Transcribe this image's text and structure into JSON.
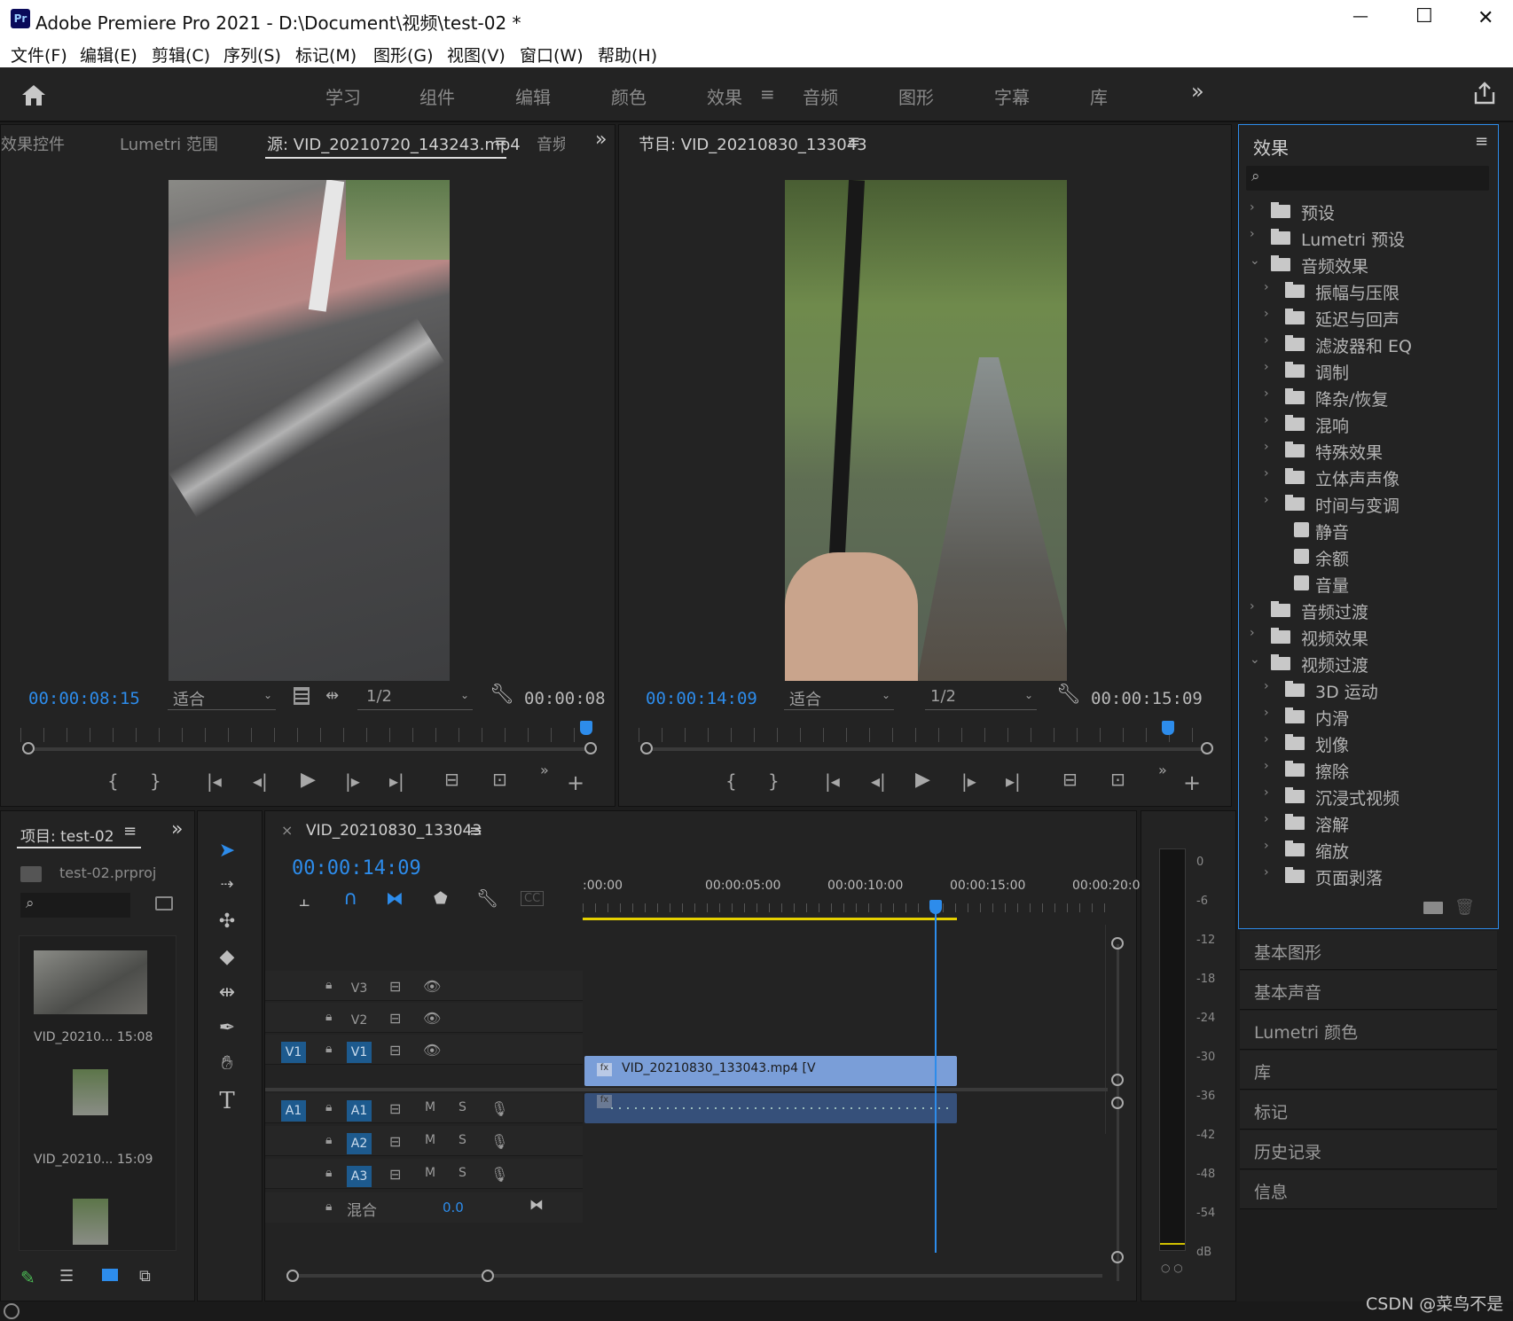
{
  "window": {
    "app_badge": "Pr",
    "title": "Adobe Premiere Pro 2021 - D:\\Document\\视频\\test-02 *",
    "min": "—",
    "max": "☐",
    "close": "✕"
  },
  "menu": [
    "文件(F)",
    "编辑(E)",
    "剪辑(C)",
    "序列(S)",
    "标记(M)",
    "图形(G)",
    "视图(V)",
    "窗口(W)",
    "帮助(H)"
  ],
  "workspaces": {
    "items": [
      "学习",
      "组件",
      "编辑",
      "颜色",
      "效果",
      "音频",
      "图形",
      "字幕",
      "库"
    ],
    "active": "效果",
    "more": "»"
  },
  "source": {
    "tabs": [
      "效果控件",
      "Lumetri 范围",
      "源: VID_20210720_143243.mp4",
      "音频"
    ],
    "menu_glyph": "≡",
    "more": "»",
    "timecode": "00:00:08:15",
    "fit": "适合",
    "res": "1/2",
    "duration": "00:00:08"
  },
  "program": {
    "title": "节目: VID_20210830_133043",
    "menu_glyph": "≡",
    "timecode": "00:00:14:09",
    "fit": "适合",
    "res": "1/2",
    "duration": "00:00:15:09"
  },
  "effects": {
    "title": "效果",
    "menu_glyph": "≡",
    "items": [
      {
        "label": "预设",
        "level": 0,
        "kind": "star",
        "arrow": "›"
      },
      {
        "label": "Lumetri 预设",
        "level": 0,
        "kind": "star",
        "arrow": "›"
      },
      {
        "label": "音频效果",
        "level": 0,
        "kind": "folder",
        "arrow": "⌄"
      },
      {
        "label": "振幅与压限",
        "level": 1,
        "kind": "folder",
        "arrow": "›"
      },
      {
        "label": "延迟与回声",
        "level": 1,
        "kind": "folder",
        "arrow": "›"
      },
      {
        "label": "滤波器和 EQ",
        "level": 1,
        "kind": "folder",
        "arrow": "›"
      },
      {
        "label": "调制",
        "level": 1,
        "kind": "folder",
        "arrow": "›"
      },
      {
        "label": "降杂/恢复",
        "level": 1,
        "kind": "folder",
        "arrow": "›"
      },
      {
        "label": "混响",
        "level": 1,
        "kind": "folder",
        "arrow": "›"
      },
      {
        "label": "特殊效果",
        "level": 1,
        "kind": "folder",
        "arrow": "›"
      },
      {
        "label": "立体声声像",
        "level": 1,
        "kind": "folder",
        "arrow": "›"
      },
      {
        "label": "时间与变调",
        "level": 1,
        "kind": "folder",
        "arrow": "›"
      },
      {
        "label": "静音",
        "level": 1,
        "kind": "fx",
        "arrow": ""
      },
      {
        "label": "余额",
        "level": 1,
        "kind": "fx",
        "arrow": ""
      },
      {
        "label": "音量",
        "level": 1,
        "kind": "fx",
        "arrow": ""
      },
      {
        "label": "音频过渡",
        "level": 0,
        "kind": "folder",
        "arrow": "›"
      },
      {
        "label": "视频效果",
        "level": 0,
        "kind": "folder",
        "arrow": "›"
      },
      {
        "label": "视频过渡",
        "level": 0,
        "kind": "folder",
        "arrow": "⌄"
      },
      {
        "label": "3D 运动",
        "level": 1,
        "kind": "folder",
        "arrow": "›"
      },
      {
        "label": "内滑",
        "level": 1,
        "kind": "folder",
        "arrow": "›"
      },
      {
        "label": "划像",
        "level": 1,
        "kind": "folder",
        "arrow": "›"
      },
      {
        "label": "擦除",
        "level": 1,
        "kind": "folder",
        "arrow": "›"
      },
      {
        "label": "沉浸式视频",
        "level": 1,
        "kind": "folder",
        "arrow": "›"
      },
      {
        "label": "溶解",
        "level": 1,
        "kind": "folder",
        "arrow": "›"
      },
      {
        "label": "缩放",
        "level": 1,
        "kind": "folder",
        "arrow": "›"
      },
      {
        "label": "页面剥落",
        "level": 1,
        "kind": "folder",
        "arrow": "›"
      }
    ]
  },
  "side_panels": [
    "基本图形",
    "基本声音",
    "Lumetri 颜色",
    "库",
    "标记",
    "历史记录",
    "信息"
  ],
  "project": {
    "title": "项目: test-02",
    "menu_glyph": "≡",
    "more": "»",
    "file": "test-02.prproj",
    "clips": [
      {
        "name": "VID_20210...",
        "dur": "15:08"
      },
      {
        "name": "VID_20210...",
        "dur": "15:09"
      }
    ]
  },
  "timeline": {
    "close": "×",
    "title": "VID_20210830_133043",
    "menu_glyph": "≡",
    "timecode": "00:00:14:09",
    "ruler": [
      ":00:00",
      "00:00:05:00",
      "00:00:10:00",
      "00:00:15:00",
      "00:00:20:00"
    ],
    "playhead_sec": 14.4,
    "video_tracks": [
      "V3",
      "V2",
      "V1"
    ],
    "audio_tracks": [
      "A1",
      "A2",
      "A3"
    ],
    "source_v": "V1",
    "source_a": "A1",
    "mix_label": "混合",
    "mix_value": "0.0",
    "clip_label": "VID_20210830_133043.mp4 [V",
    "m": "M",
    "s": "S"
  },
  "meter": {
    "ticks": [
      "0",
      "-6",
      "-12",
      "-18",
      "-24",
      "-30",
      "-36",
      "-42",
      "-48",
      "-54",
      "dB"
    ]
  },
  "watermark": "CSDN @菜鸟不是"
}
